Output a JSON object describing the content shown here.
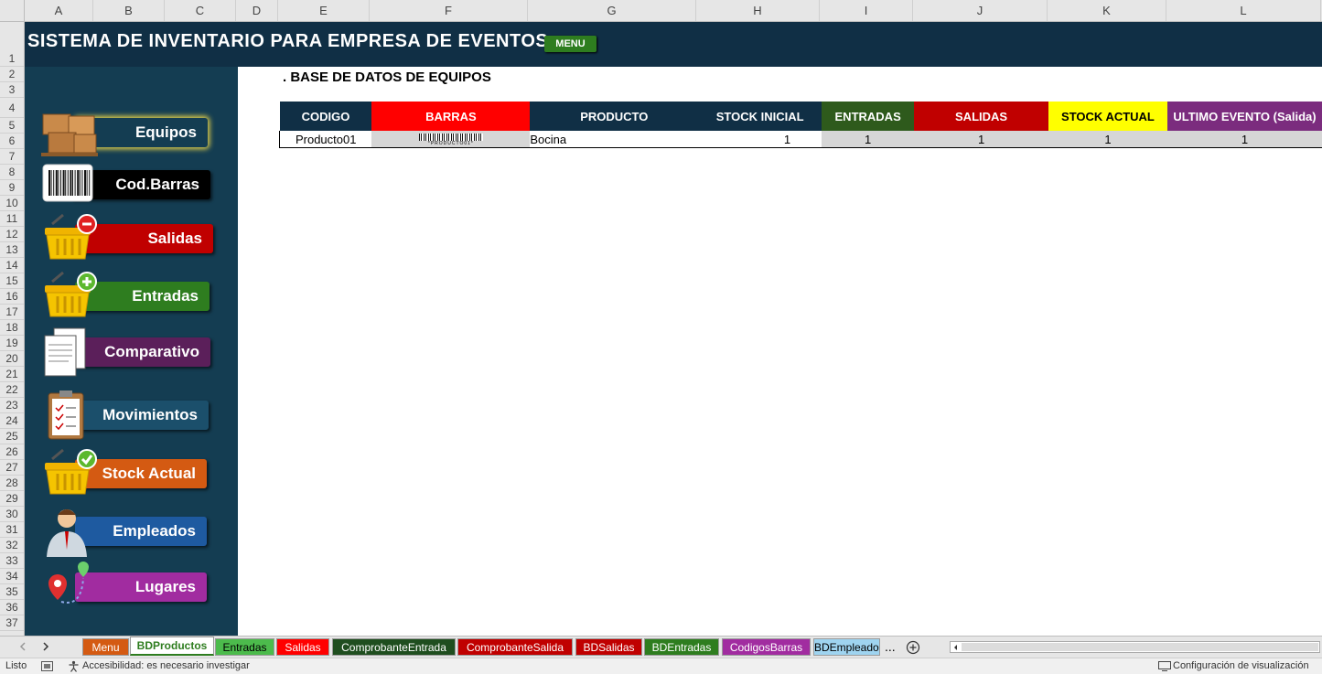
{
  "columns": [
    "A",
    "B",
    "C",
    "D",
    "E",
    "F",
    "G",
    "H",
    "I",
    "J",
    "K",
    "L"
  ],
  "rows": [
    "1",
    "2",
    "3",
    "4",
    "5",
    "6",
    "7",
    "8",
    "9",
    "10",
    "11",
    "12",
    "13",
    "14",
    "15",
    "16",
    "17",
    "18",
    "19",
    "20",
    "21",
    "22",
    "23",
    "24",
    "25",
    "26",
    "27",
    "28",
    "29",
    "30",
    "31",
    "32",
    "33",
    "34",
    "35",
    "36",
    "37"
  ],
  "header": {
    "title": "SISTEMA DE INVENTARIO PARA EMPRESA DE EVENTOS",
    "menu_label": "MENU"
  },
  "sidebar": {
    "items": [
      {
        "label": "Equipos",
        "color": "#143d52",
        "icon": "boxes-icon"
      },
      {
        "label": "Cod.Barras",
        "color": "#000000",
        "icon": "barcode-icon"
      },
      {
        "label": "Salidas",
        "color": "#c00000",
        "icon": "basket-minus-icon"
      },
      {
        "label": "Entradas",
        "color": "#2e7d1f",
        "icon": "basket-plus-icon"
      },
      {
        "label": "Comparativo",
        "color": "#5b1f5a",
        "icon": "documents-icon"
      },
      {
        "label": "Movimientos",
        "color": "#1b4f6b",
        "icon": "clipboard-icon"
      },
      {
        "label": "Stock Actual",
        "color": "#d45a12",
        "icon": "basket-check-icon"
      },
      {
        "label": "Empleados",
        "color": "#1e5aa0",
        "icon": "person-icon"
      },
      {
        "label": "Lugares",
        "color": "#a12ca0",
        "icon": "map-pin-icon"
      }
    ]
  },
  "main": {
    "section_title": ". BASE DE DATOS DE EQUIPOS",
    "table": {
      "headers": [
        {
          "label": "CODIGO",
          "bg": "#102f45",
          "fg": "#ffffff"
        },
        {
          "label": "BARRAS",
          "bg": "#ff0000",
          "fg": "#ffffff"
        },
        {
          "label": "PRODUCTO",
          "bg": "#102f45",
          "fg": "#ffffff"
        },
        {
          "label": "STOCK INICIAL",
          "bg": "#102f45",
          "fg": "#ffffff"
        },
        {
          "label": "ENTRADAS",
          "bg": "#2e5a1c",
          "fg": "#ffffff"
        },
        {
          "label": "SALIDAS",
          "bg": "#c00000",
          "fg": "#ffffff"
        },
        {
          "label": "STOCK ACTUAL",
          "bg": "#ffff00",
          "fg": "#000000"
        },
        {
          "label": "ULTIMO EVENTO (Salida)",
          "bg": "#7b2c7e",
          "fg": "#ffffff"
        }
      ],
      "rows": [
        {
          "codigo": "Producto01",
          "barcode_text": "*PRODUCTO01*",
          "producto": "Bocina",
          "stock_inicial": "1",
          "entradas": "1",
          "salidas": "1",
          "stock_actual": "1",
          "ultimo_evento": "1"
        }
      ]
    }
  },
  "sheet_tabs": [
    {
      "label": "Menu",
      "bg": "#d45a12",
      "fg": "#ffffff",
      "active": false
    },
    {
      "label": "BDProductos",
      "bg": "#ffffff",
      "fg": "#2e7d1f",
      "active": true
    },
    {
      "label": "Entradas",
      "bg": "#4cbb4c",
      "fg": "#000000",
      "active": false
    },
    {
      "label": "Salidas",
      "bg": "#ff0000",
      "fg": "#ffffff",
      "active": false
    },
    {
      "label": "ComprobanteEntrada",
      "bg": "#1f4e1f",
      "fg": "#ffffff",
      "active": false
    },
    {
      "label": "ComprobanteSalida",
      "bg": "#c00000",
      "fg": "#ffffff",
      "active": false
    },
    {
      "label": "BDSalidas",
      "bg": "#c00000",
      "fg": "#ffffff",
      "active": false
    },
    {
      "label": "BDEntradas",
      "bg": "#2e7d1f",
      "fg": "#ffffff",
      "active": false
    },
    {
      "label": "CodigosBarras",
      "bg": "#a12ca0",
      "fg": "#ffffff",
      "active": false
    },
    {
      "label": "BDEmpleados",
      "bg": "#9fd4f0",
      "fg": "#000000",
      "active": false
    }
  ],
  "tab_more": "...",
  "status": {
    "ready": "Listo",
    "accessibility": "Accesibilidad: es necesario investigar",
    "view_settings": "Configuración de visualización"
  }
}
